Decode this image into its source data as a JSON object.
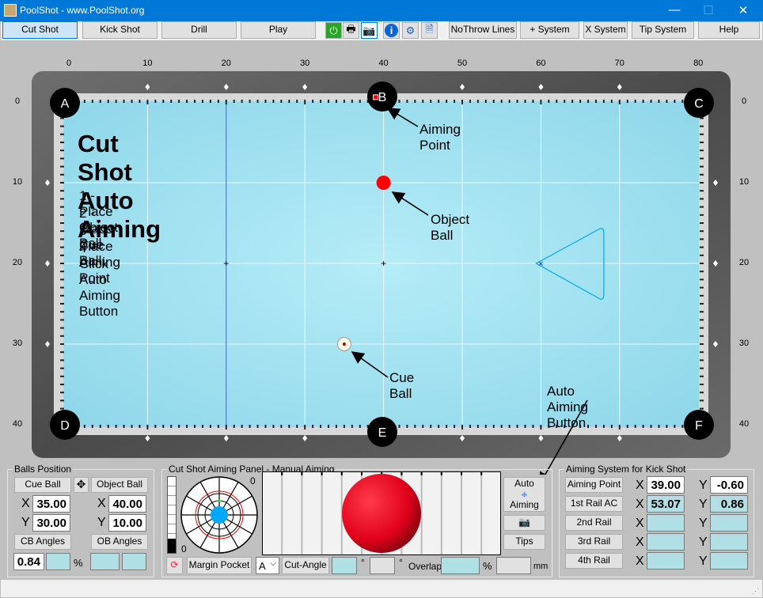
{
  "window": {
    "title": "PoolShot - www.PoolShot.org",
    "minimize": "—",
    "maximize": "☐",
    "close": "✕"
  },
  "toolbar": {
    "modes": [
      {
        "label": "Cut Shot",
        "selected": true
      },
      {
        "label": "Kick Shot"
      },
      {
        "label": "Drill"
      },
      {
        "label": "Play"
      }
    ],
    "icons": [
      "power-icon",
      "print-icon",
      "camera-icon",
      "info-icon",
      "settings-gear-icon",
      "help-document-icon"
    ],
    "options": [
      "NoThrow Lines",
      "+ System",
      "X System",
      "Tip System",
      "Help"
    ]
  },
  "table": {
    "x_ticks": [
      "0",
      "10",
      "20",
      "30",
      "40",
      "50",
      "60",
      "70",
      "80"
    ],
    "y_ticks": [
      "0",
      "10",
      "20",
      "30",
      "40"
    ],
    "pockets": {
      "A": "A",
      "B": "B",
      "C": "C",
      "D": "D",
      "E": "E",
      "F": "F"
    },
    "heading": "Cut Shot Auto Aiming",
    "steps": [
      "1 - Place Object Ball",
      "2 - Place Cue Ball",
      "3 - Place Aiming Point",
      "4 - Click Auto Aiming Button"
    ],
    "annotations": {
      "aiming_point": "Aiming Point",
      "object_ball": "Object Ball",
      "cue_ball": "Cue Ball",
      "auto_aiming": "Auto Aiming Button"
    },
    "cue_ball": {
      "x": 35,
      "y": 30
    },
    "object_ball": {
      "x": 40,
      "y": 10
    },
    "aiming_point": {
      "x": 39,
      "y": -0.6
    },
    "colors": {
      "felt": "#a4e4f2",
      "object_ball": "#ff0000",
      "rail": "#5b5b5b",
      "guide_line": "#3355ff"
    }
  },
  "balls_position": {
    "title": "Balls Position",
    "cue_ball": "Cue Ball",
    "object_ball": "Object Ball",
    "x_label": "X",
    "y_label": "Y",
    "cb_x": "35.00",
    "cb_y": "30.00",
    "ob_x": "40.00",
    "ob_y": "10.00",
    "cb_angles": "CB Angles",
    "ob_angles": "OB Angles",
    "cb_value": "0.84",
    "percent": "%"
  },
  "cut_panel": {
    "title": "Cut Shot Aiming Panel - Manual Aiming",
    "zero_top": "0",
    "zero_bottom": "0",
    "margin_pocket": "Margin Pocket",
    "pocket_select": "A",
    "cut_angle": "Cut-Angle",
    "deg": "°",
    "overlap": "Overlap",
    "percent": "%",
    "mm": "mm",
    "auto_aiming_top": "Auto",
    "auto_aiming_bottom": "Aiming",
    "tips": "Tips"
  },
  "kick_panel": {
    "title": "Aiming System for Kick Shot",
    "rows": [
      {
        "label": "Aiming Point",
        "x": "39.00",
        "y": "-0.60",
        "editable": true
      },
      {
        "label": "1st Rail AC",
        "x": "53.07",
        "y": "0.86"
      },
      {
        "label": "2nd Rail",
        "x": "",
        "y": ""
      },
      {
        "label": "3rd Rail",
        "x": "",
        "y": ""
      },
      {
        "label": "4th Rail",
        "x": "",
        "y": ""
      }
    ],
    "x_label": "X",
    "y_label": "Y"
  }
}
